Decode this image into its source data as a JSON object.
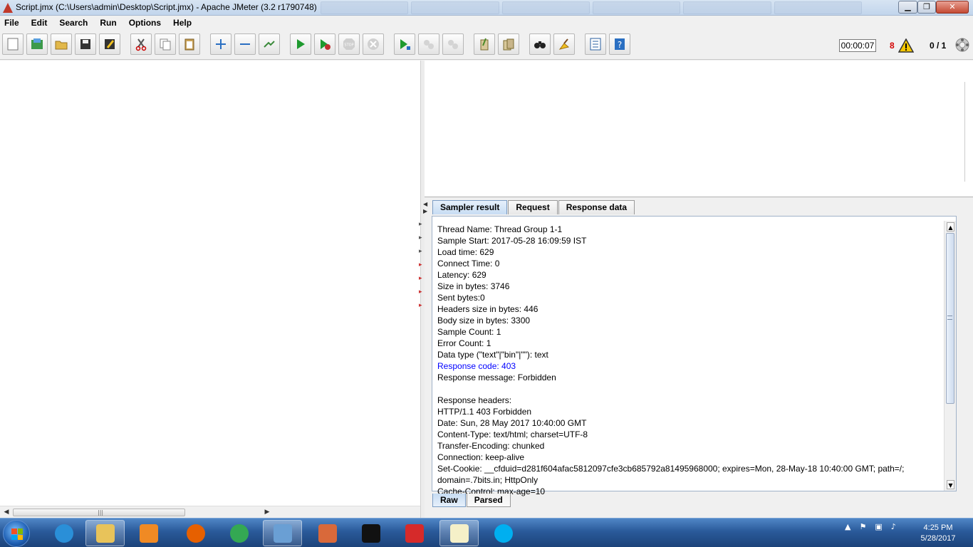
{
  "window": {
    "title": "Script.jmx (C:\\Users\\admin\\Desktop\\Script.jmx) - Apache JMeter (3.2 r1790748)",
    "minimize": "▁",
    "maximize": "❐",
    "close": "✕"
  },
  "menu": [
    "File",
    "Edit",
    "Search",
    "Run",
    "Options",
    "Help"
  ],
  "toolbar": {
    "buttons": [
      {
        "name": "new-icon"
      },
      {
        "name": "templates-icon"
      },
      {
        "name": "open-icon"
      },
      {
        "name": "save-icon"
      },
      {
        "name": "save-as-icon"
      },
      {
        "name": "cut-icon"
      },
      {
        "name": "copy-icon"
      },
      {
        "name": "paste-icon"
      },
      {
        "name": "expand-icon"
      },
      {
        "name": "collapse-icon"
      },
      {
        "name": "toggle-icon"
      },
      {
        "name": "start-icon"
      },
      {
        "name": "start-no-pause-icon"
      },
      {
        "name": "stop-icon"
      },
      {
        "name": "shutdown-icon"
      },
      {
        "name": "remote-start-icon"
      },
      {
        "name": "remote-stop-icon"
      },
      {
        "name": "remote-shutdown-icon"
      },
      {
        "name": "clear-icon"
      },
      {
        "name": "clear-all-icon"
      },
      {
        "name": "search-icon"
      },
      {
        "name": "reset-search-icon"
      },
      {
        "name": "function-helper-icon"
      },
      {
        "name": "help-icon"
      }
    ],
    "stop_label": "STOP",
    "timer": "00:00:07",
    "error_count": "8",
    "threads": "0 / 1"
  },
  "result": {
    "tabs": [
      "Sampler result",
      "Request",
      "Response data"
    ],
    "active_tab": "Sampler result",
    "lines": [
      {
        "text": "Thread Name: Thread Group 1-1",
        "style": ""
      },
      {
        "text": "Sample Start: 2017-05-28 16:09:59 IST",
        "style": ""
      },
      {
        "text": "Load time: 629",
        "style": ""
      },
      {
        "text": "Connect Time: 0",
        "style": ""
      },
      {
        "text": "Latency: 629",
        "style": ""
      },
      {
        "text": "Size in bytes: 3746",
        "style": ""
      },
      {
        "text": "Sent bytes:0",
        "style": ""
      },
      {
        "text": "Headers size in bytes: 446",
        "style": ""
      },
      {
        "text": "Body size in bytes: 3300",
        "style": ""
      },
      {
        "text": "Sample Count: 1",
        "style": ""
      },
      {
        "text": "Error Count: 1",
        "style": ""
      },
      {
        "text": "Data type (\"text\"|\"bin\"|\"\"): text",
        "style": ""
      },
      {
        "text": "Response code: 403",
        "style": "blue"
      },
      {
        "text": "Response message: Forbidden",
        "style": ""
      },
      {
        "text": "",
        "style": ""
      },
      {
        "text": "Response headers:",
        "style": ""
      },
      {
        "text": "HTTP/1.1 403 Forbidden",
        "style": ""
      },
      {
        "text": "Date: Sun, 28 May 2017 10:40:00 GMT",
        "style": ""
      },
      {
        "text": "Content-Type: text/html; charset=UTF-8",
        "style": ""
      },
      {
        "text": "Transfer-Encoding: chunked",
        "style": ""
      },
      {
        "text": "Connection: keep-alive",
        "style": ""
      },
      {
        "text": "Set-Cookie: __cfduid=d281f604afac5812097cfe3cb685792a81495968000; expires=Mon, 28-May-18 10:40:00 GMT; path=/;",
        "style": ""
      },
      {
        "text": "domain=.7bits.in; HttpOnly",
        "style": ""
      },
      {
        "text": "Cache-Control: max-age=10",
        "style": ""
      }
    ],
    "bottom_tabs": [
      "Raw",
      "Parsed"
    ],
    "active_bottom_tab": "Raw"
  },
  "taskbar": {
    "apps": [
      {
        "name": "internet-explorer-icon",
        "color": "#2a8fd8"
      },
      {
        "name": "file-explorer-icon",
        "color": "#e8c35a"
      },
      {
        "name": "media-player-icon",
        "color": "#f08a24"
      },
      {
        "name": "firefox-icon",
        "color": "#e66000"
      },
      {
        "name": "chrome-icon",
        "color": "#34a853"
      },
      {
        "name": "control-panel-icon",
        "color": "#6a9fd4"
      },
      {
        "name": "volume-mixer-icon",
        "color": "#d9693a"
      },
      {
        "name": "command-prompt-icon",
        "color": "#111111"
      },
      {
        "name": "feather-pen-icon",
        "color": "#d62a2a"
      },
      {
        "name": "jmeter-face-icon",
        "color": "#f5f0c8"
      },
      {
        "name": "skype-icon",
        "color": "#00aff0"
      }
    ],
    "clock_time": "4:25 PM",
    "clock_date": "5/28/2017"
  }
}
